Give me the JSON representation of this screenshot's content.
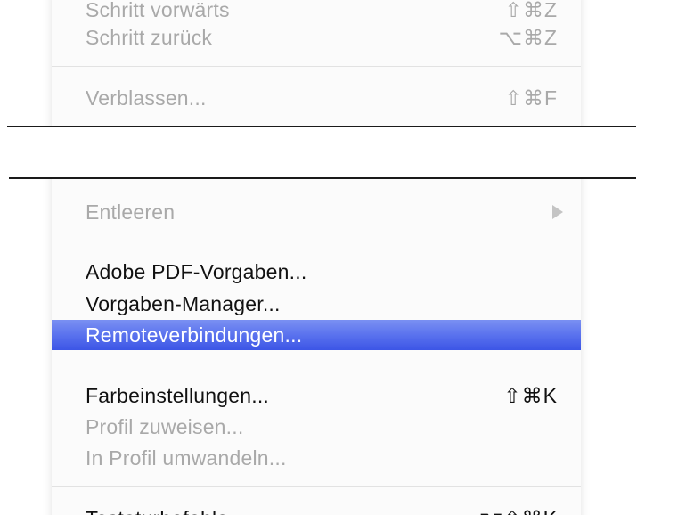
{
  "menu": {
    "items": [
      {
        "label": "Schritt vorwärts",
        "shortcut": "⇧⌘Z"
      },
      {
        "label": "Schritt zurück",
        "shortcut": "⌥⌘Z"
      },
      {
        "label": "Verblassen...",
        "shortcut": "⇧⌘F"
      },
      {
        "label": "Entleeren",
        "submenu_icon": "triangle-right-icon"
      },
      {
        "label": "Adobe PDF-Vorgaben..."
      },
      {
        "label": "Vorgaben-Manager..."
      },
      {
        "label": "Remoteverbindungen...",
        "state": "highlighted"
      },
      {
        "label": "Farbeinstellungen...",
        "shortcut": "⇧⌘K"
      },
      {
        "label": "Profil zuweisen..."
      },
      {
        "label": "In Profil umwandeln..."
      },
      {
        "label": "Tastaturbefehle...",
        "shortcut": "⌥⇧⌘K"
      }
    ]
  },
  "colors": {
    "highlight": "#4a63ea",
    "disabled_text": "#a9a9a9",
    "enabled_text": "#111111"
  }
}
